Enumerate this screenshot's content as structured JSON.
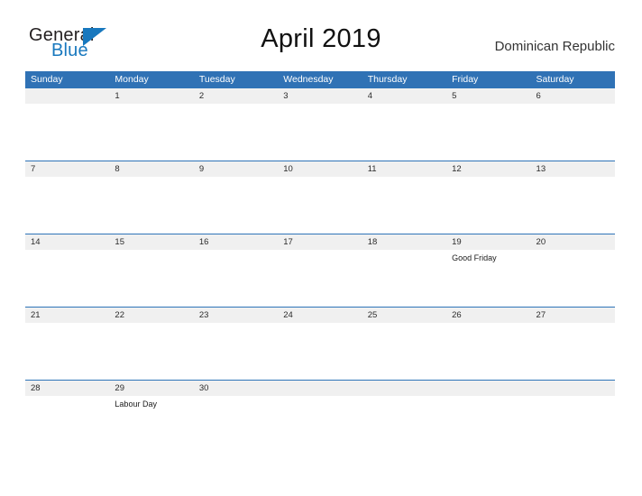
{
  "brand": {
    "name_part1": "General",
    "name_part2": "Blue",
    "triangle_color": "#1878be",
    "text_color": "#231f20"
  },
  "header": {
    "title": "April 2019",
    "country": "Dominican Republic"
  },
  "theme": {
    "header_blue": "#3072b5",
    "row_line_blue": "#2e74b8",
    "date_strip_gray": "#f0f0f0",
    "page_background": "#ffffff"
  },
  "calendar": {
    "day_headers": [
      "Sunday",
      "Monday",
      "Tuesday",
      "Wednesday",
      "Thursday",
      "Friday",
      "Saturday"
    ],
    "weeks": [
      [
        {
          "date": "",
          "event": ""
        },
        {
          "date": "1",
          "event": ""
        },
        {
          "date": "2",
          "event": ""
        },
        {
          "date": "3",
          "event": ""
        },
        {
          "date": "4",
          "event": ""
        },
        {
          "date": "5",
          "event": ""
        },
        {
          "date": "6",
          "event": ""
        }
      ],
      [
        {
          "date": "7",
          "event": ""
        },
        {
          "date": "8",
          "event": ""
        },
        {
          "date": "9",
          "event": ""
        },
        {
          "date": "10",
          "event": ""
        },
        {
          "date": "11",
          "event": ""
        },
        {
          "date": "12",
          "event": ""
        },
        {
          "date": "13",
          "event": ""
        }
      ],
      [
        {
          "date": "14",
          "event": ""
        },
        {
          "date": "15",
          "event": ""
        },
        {
          "date": "16",
          "event": ""
        },
        {
          "date": "17",
          "event": ""
        },
        {
          "date": "18",
          "event": ""
        },
        {
          "date": "19",
          "event": "Good Friday"
        },
        {
          "date": "20",
          "event": ""
        }
      ],
      [
        {
          "date": "21",
          "event": ""
        },
        {
          "date": "22",
          "event": ""
        },
        {
          "date": "23",
          "event": ""
        },
        {
          "date": "24",
          "event": ""
        },
        {
          "date": "25",
          "event": ""
        },
        {
          "date": "26",
          "event": ""
        },
        {
          "date": "27",
          "event": ""
        }
      ],
      [
        {
          "date": "28",
          "event": ""
        },
        {
          "date": "29",
          "event": "Labour Day"
        },
        {
          "date": "30",
          "event": ""
        },
        {
          "date": "",
          "event": ""
        },
        {
          "date": "",
          "event": ""
        },
        {
          "date": "",
          "event": ""
        },
        {
          "date": "",
          "event": ""
        }
      ]
    ]
  }
}
